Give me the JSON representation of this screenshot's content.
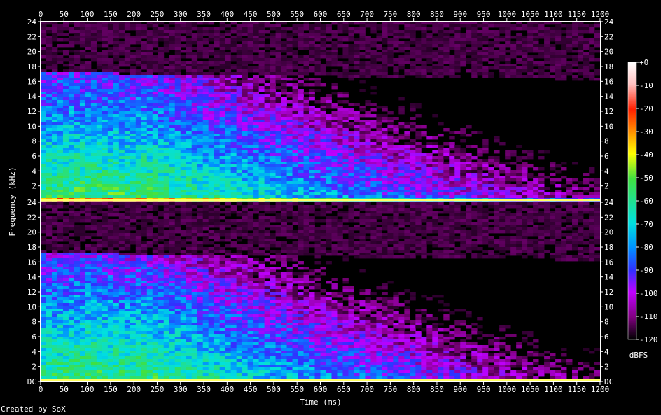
{
  "chart_data": {
    "type": "heatmap",
    "title": "",
    "xlabel": "Time (ms)",
    "ylabel": "Frequency (kHz)",
    "colorbar_label": "dBFS",
    "x_ticks": [
      0,
      50,
      100,
      150,
      200,
      250,
      300,
      350,
      400,
      450,
      500,
      550,
      600,
      650,
      700,
      750,
      800,
      850,
      900,
      950,
      1000,
      1050,
      1100,
      1150,
      1200
    ],
    "y_ticks_upper": [
      "24",
      "22",
      "20",
      "18",
      "16",
      "14",
      "12",
      "10",
      "8",
      "6",
      "4",
      "2"
    ],
    "y_ticks_lower": [
      "24",
      "22",
      "20",
      "18",
      "16",
      "14",
      "12",
      "10",
      "8",
      "6",
      "4",
      "2",
      "DC"
    ],
    "y_tick_values_upper": [
      24,
      22,
      20,
      18,
      16,
      14,
      12,
      10,
      8,
      6,
      4,
      2
    ],
    "y_tick_values_lower": [
      24,
      22,
      20,
      18,
      16,
      14,
      12,
      10,
      8,
      6,
      4,
      2,
      0
    ],
    "colorbar_ticks": [
      "+0",
      "-10",
      "-20",
      "-30",
      "-40",
      "-50",
      "-60",
      "-70",
      "-80",
      "-90",
      "-100",
      "-110",
      "-120"
    ],
    "colorbar_values": [
      0,
      -10,
      -20,
      -30,
      -40,
      -50,
      -60,
      -70,
      -80,
      -90,
      -100,
      -110,
      -120
    ],
    "xlim": [
      0,
      1200
    ],
    "ylim": [
      0,
      24
    ],
    "zlim": [
      -120,
      0
    ],
    "channels": 2,
    "colors": {
      "hot": "#ffffff",
      "red": "#ff2000",
      "yellow": "#ffff00",
      "green": "#40e040",
      "cyan": "#00e0e0",
      "blue": "#3030ff",
      "magenta": "#e000e0",
      "dark": "#000000"
    }
  },
  "credit": "Created by SoX"
}
